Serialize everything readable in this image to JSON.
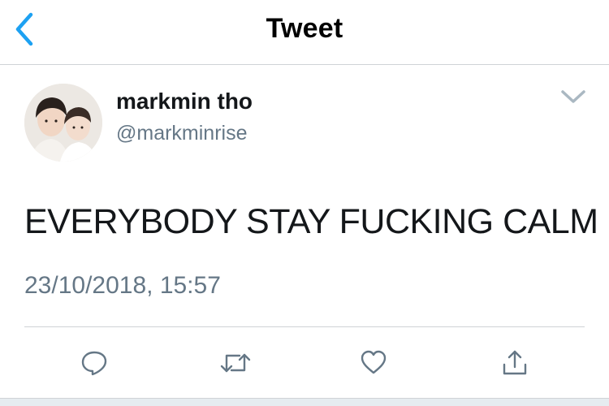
{
  "header": {
    "title": "Tweet",
    "back_icon": "chevron-left-icon"
  },
  "tweet": {
    "display_name": "markmin tho",
    "handle": "@markminrise",
    "text": "EVERYBODY STAY FUCKING CALM",
    "timestamp": "23/10/2018, 15:57",
    "menu_icon": "chevron-down-icon"
  },
  "actions": [
    {
      "name": "reply",
      "icon": "reply-icon"
    },
    {
      "name": "retweet",
      "icon": "retweet-icon"
    },
    {
      "name": "like",
      "icon": "heart-icon"
    },
    {
      "name": "share",
      "icon": "share-icon"
    }
  ],
  "colors": {
    "accent": "#1da1f2",
    "text": "#14171a",
    "secondary": "#657786",
    "divider": "#cfd3d6",
    "icon": "#657786"
  }
}
